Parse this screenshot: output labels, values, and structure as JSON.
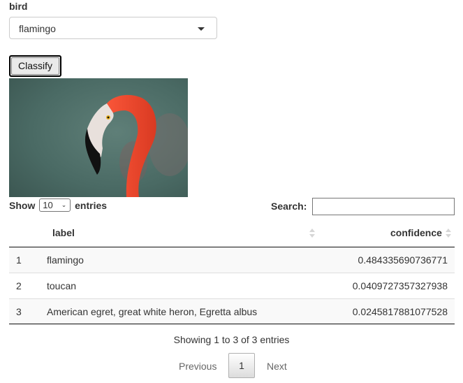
{
  "form": {
    "field_label": "bird",
    "selected": "flamingo",
    "button_label": "Classify"
  },
  "table_controls": {
    "show_prefix": "Show",
    "page_length": "10",
    "show_suffix": "entries",
    "search_label": "Search:",
    "search_value": ""
  },
  "table": {
    "columns": [
      "label",
      "confidence"
    ],
    "rows": [
      {
        "index": "1",
        "label": "flamingo",
        "confidence": "0.484335690736771"
      },
      {
        "index": "2",
        "label": "toucan",
        "confidence": "0.0409727357327938"
      },
      {
        "index": "3",
        "label": "American egret, great white heron, Egretta albus",
        "confidence": "0.0245817881077528"
      }
    ]
  },
  "footer": {
    "info": "Showing 1 to 3 of 3 entries",
    "previous": "Previous",
    "current_page": "1",
    "next": "Next"
  },
  "icons": {
    "dropdown": "caret-down-icon",
    "sort": "sort-both-icon"
  },
  "colors": {
    "header_rule": "#111111",
    "odd_row": "#f9f9f9",
    "flamingo": "#e8452c",
    "photo_bg": "#4f6e68"
  }
}
